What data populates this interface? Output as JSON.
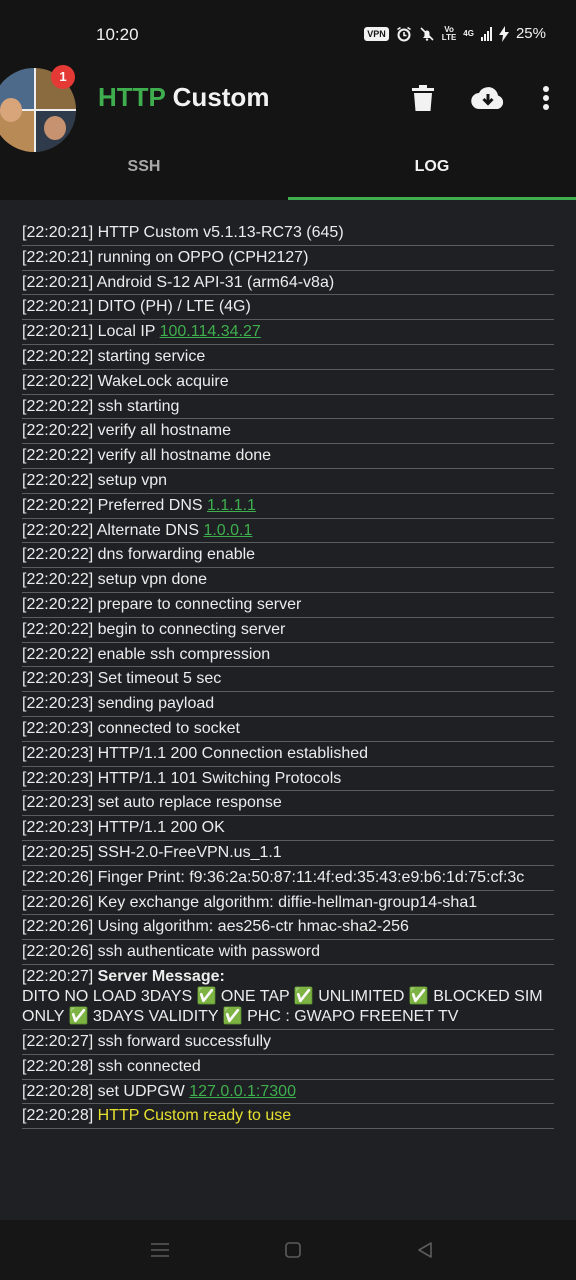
{
  "status": {
    "time": "10:20",
    "vpn": "VPN",
    "volte_top": "Vo",
    "volte_bottom": "LTE",
    "network": "4G",
    "battery": "25%"
  },
  "header": {
    "title_part1": "HTTP",
    "title_part2": "Custom",
    "notification_count": "1",
    "accent": "#3fae4e"
  },
  "tabs": [
    {
      "label": "SSH",
      "active": false
    },
    {
      "label": "LOG",
      "active": true
    }
  ],
  "log": {
    "lines": [
      {
        "time": "[22:20:21]",
        "text": "HTTP Custom v5.1.13-RC73 (645)"
      },
      {
        "time": "[22:20:21]",
        "text": "running on OPPO (CPH2127)"
      },
      {
        "time": "[22:20:21]",
        "text": "Android S-12 API-31 (arm64-v8a)"
      },
      {
        "time": "[22:20:21]",
        "text": "DITO (PH) / LTE (4G)"
      },
      {
        "time": "[22:20:21]",
        "text": "Local IP",
        "link": "100.114.34.27"
      },
      {
        "time": "[22:20:22]",
        "text": "starting service"
      },
      {
        "time": "[22:20:22]",
        "text": "WakeLock acquire"
      },
      {
        "time": "[22:20:22]",
        "text": "ssh starting"
      },
      {
        "time": "[22:20:22]",
        "text": "verify all hostname"
      },
      {
        "time": "[22:20:22]",
        "text": "verify all hostname done"
      },
      {
        "time": "[22:20:22]",
        "text": "setup vpn"
      },
      {
        "time": "[22:20:22]",
        "text": "Preferred DNS",
        "link": "1.1.1.1"
      },
      {
        "time": "[22:20:22]",
        "text": "Alternate DNS",
        "link": "1.0.0.1"
      },
      {
        "time": "[22:20:22]",
        "text": "dns forwarding enable"
      },
      {
        "time": "[22:20:22]",
        "text": "setup vpn done"
      },
      {
        "time": "[22:20:22]",
        "text": "prepare to connecting server"
      },
      {
        "time": "[22:20:22]",
        "text": "begin to connecting server"
      },
      {
        "time": "[22:20:22]",
        "text": "enable ssh compression"
      },
      {
        "time": "[22:20:23]",
        "text": "Set timeout 5 sec"
      },
      {
        "time": "[22:20:23]",
        "text": "sending payload"
      },
      {
        "time": "[22:20:23]",
        "text": "connected to socket"
      },
      {
        "time": "[22:20:23]",
        "text": "HTTP/1.1 200 Connection established"
      },
      {
        "time": "[22:20:23]",
        "text": "HTTP/1.1 101 Switching Protocols"
      },
      {
        "time": "[22:20:23]",
        "text": "set auto replace response"
      },
      {
        "time": "[22:20:23]",
        "text": "HTTP/1.1 200 OK"
      },
      {
        "time": "[22:20:25]",
        "text": "SSH-2.0-FreeVPN.us_1.1"
      },
      {
        "time": "[22:20:26]",
        "text": "Finger Print: f9:36:2a:50:87:11:4f:ed:35:43:e9:b6:1d:75:cf:3c"
      },
      {
        "time": "[22:20:26]",
        "text": "Key exchange algorithm: diffie-hellman-group14-sha1"
      },
      {
        "time": "[22:20:26]",
        "text": "Using algorithm: aes256-ctr hmac-sha2-256"
      },
      {
        "time": "[22:20:26]",
        "text": "ssh authenticate with password"
      },
      {
        "time": "[22:20:27]",
        "bold": "Server Message:",
        "message": "DITO NO LOAD 3DAYS ✅ ONE TAP ✅ UNLIMITED ✅ BLOCKED SIM ONLY ✅ 3DAYS VALIDITY ✅ PHC : GWAPO FREENET TV"
      },
      {
        "time": "[22:20:27]",
        "text": "ssh forward successfully"
      },
      {
        "time": "[22:20:28]",
        "text": "ssh connected"
      },
      {
        "time": "[22:20:28]",
        "text": "set UDPGW",
        "link": "127.0.0.1:7300"
      },
      {
        "time": "[22:20:28]",
        "highlight": "HTTP Custom ready to use"
      }
    ]
  },
  "icons": {
    "delete": "trash-icon",
    "download": "cloud-download-icon",
    "more": "more-vert-icon"
  }
}
